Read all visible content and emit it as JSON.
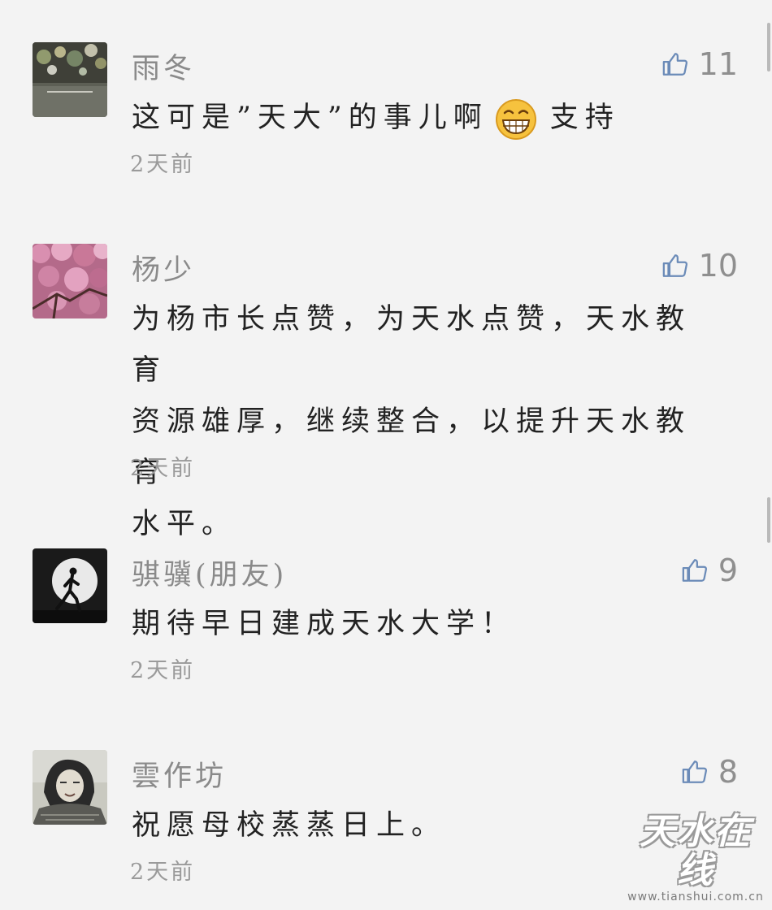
{
  "comments": [
    {
      "name": "雨冬",
      "likes": "11",
      "text": "这可是”天大”的事儿啊",
      "emoji": "grinning-face",
      "text_after": "支持",
      "time": "2天前"
    },
    {
      "name": "杨少",
      "likes": "10",
      "lines": [
        "为杨市长点赞，为天水点赞，天水教育",
        "资源雄厚，继续整合，以提升天水教育",
        "水平。"
      ],
      "time": "2天前"
    },
    {
      "name": "骐骥(朋友)",
      "likes": "9",
      "text": "期待早日建成天水大学！",
      "time": "2天前"
    },
    {
      "name": "雲作坊",
      "likes": "8",
      "text": "祝愿母校蒸蒸日上。",
      "time": "2天前"
    }
  ],
  "watermark": {
    "logo": "天水在线",
    "url": "www.tianshui.com.cn"
  },
  "icons": {
    "like": "thumbs-up-icon"
  },
  "colors": {
    "like_icon": "#6b8bb8",
    "background": "#f3f3f3",
    "name": "#8a8a8a",
    "text": "#222222"
  }
}
